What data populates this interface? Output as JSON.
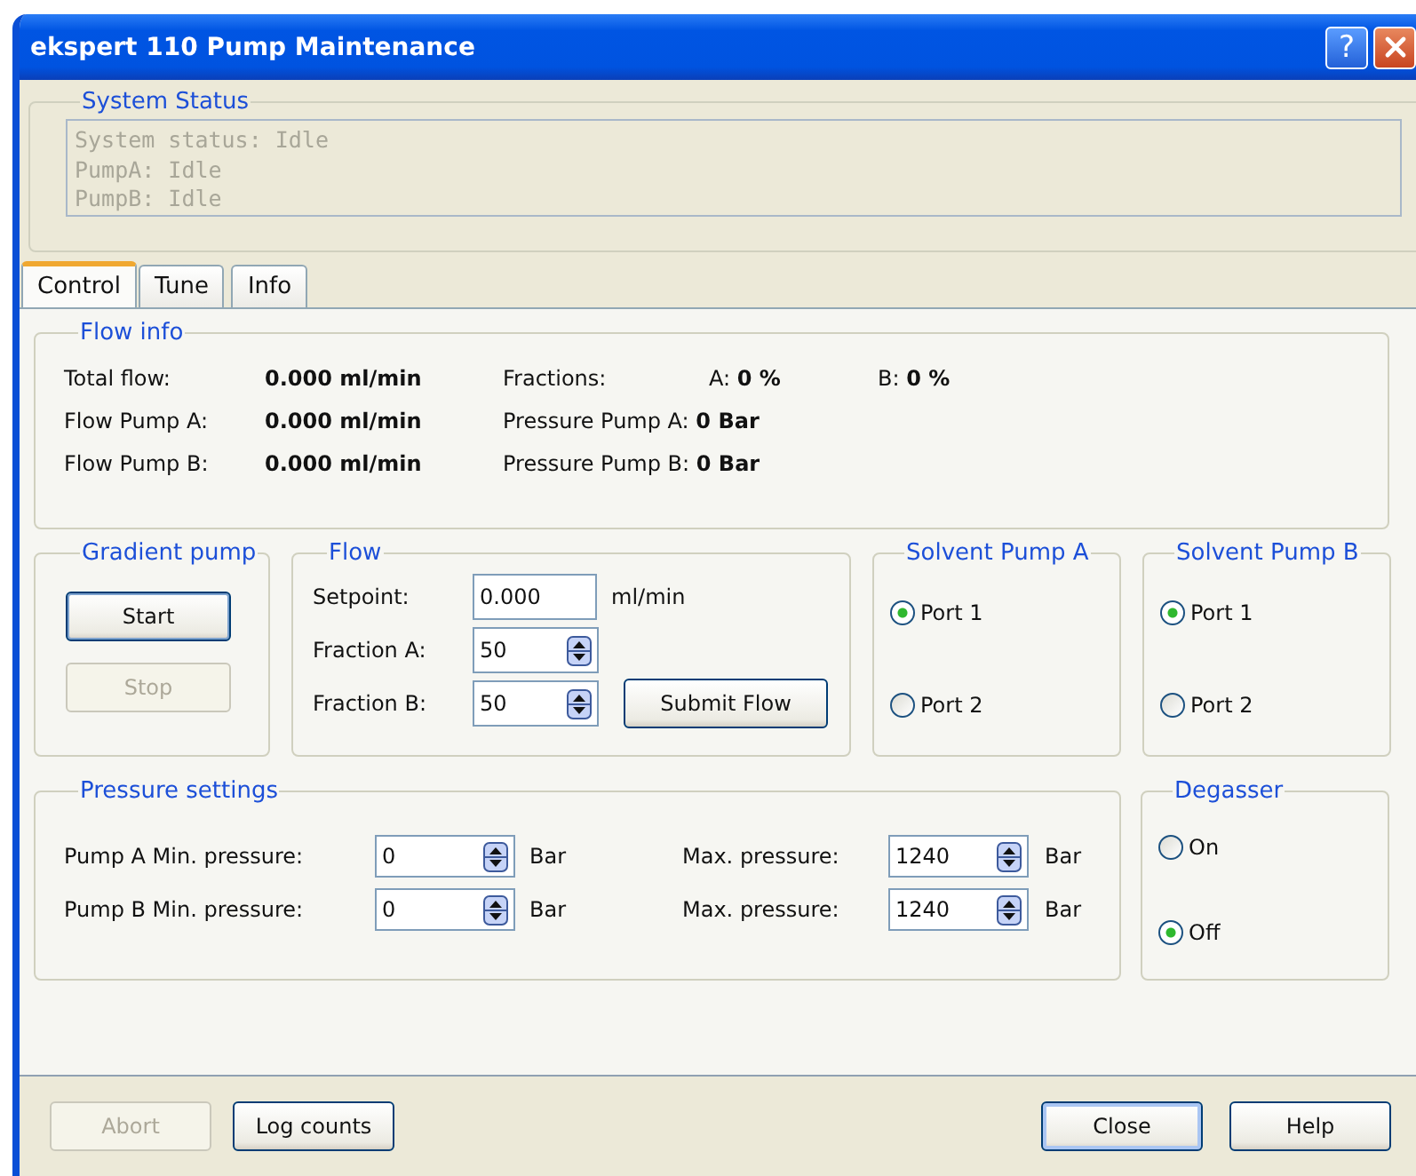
{
  "window": {
    "title": "ekspert 110 Pump Maintenance"
  },
  "title_buttons": [
    {
      "kind": "help",
      "label": "?"
    },
    {
      "kind": "close"
    }
  ],
  "system_status": {
    "title": "System Status",
    "lines": [
      "System status: Idle",
      "PumpA: Idle",
      "PumpB: Idle"
    ]
  },
  "tabs": [
    {
      "label": "Control",
      "selected": true
    },
    {
      "label": "Tune",
      "selected": false
    },
    {
      "label": "Info",
      "selected": false
    }
  ],
  "flow_info": {
    "title": "Flow info",
    "rows": [
      {
        "label": "Total flow:",
        "value": "0.000 ml/min",
        "info": [
          "Fractions:",
          "A: **0 %**",
          "B: **0 %**"
        ]
      },
      {
        "label": "Flow Pump A:",
        "value": "0.000 ml/min",
        "info": [
          "Pressure Pump A: **0 Bar**"
        ]
      },
      {
        "label": "Flow Pump B:",
        "value": "0.000 ml/min",
        "info": [
          "Pressure Pump B: **0 Bar**"
        ]
      }
    ]
  },
  "gradient_pump": {
    "title": "Gradient pump",
    "buttons": [
      {
        "label": "Start",
        "disabled": false
      },
      {
        "label": "Stop",
        "disabled": true
      }
    ]
  },
  "flow": {
    "title": "Flow",
    "setpoint": {
      "label": "Setpoint:",
      "value": "0.000",
      "unit": "ml/min"
    },
    "fractions": [
      {
        "label": "Fraction A:",
        "value": "50"
      },
      {
        "label": "Fraction B:",
        "value": "50"
      }
    ],
    "submit": "Submit Flow"
  },
  "solvent_pumps": [
    {
      "title": "Solvent Pump A",
      "options": [
        {
          "label": "Port 1",
          "selected": true
        },
        {
          "label": "Port 2",
          "selected": false
        }
      ]
    },
    {
      "title": "Solvent Pump B",
      "options": [
        {
          "label": "Port 1",
          "selected": true
        },
        {
          "label": "Port 2",
          "selected": false
        }
      ]
    }
  ],
  "pressure_settings": {
    "title": "Pressure settings",
    "rows": [
      {
        "label": "Pump A Min. pressure:",
        "min": "0",
        "unit": "Bar",
        "max_label": "Max. pressure:",
        "max": "1240",
        "max_unit": "Bar"
      },
      {
        "label": "Pump B Min. pressure:",
        "min": "0",
        "unit": "Bar",
        "max_label": "Max. pressure:",
        "max": "1240",
        "max_unit": "Bar"
      }
    ]
  },
  "degasser": {
    "title": "Degasser",
    "options": [
      {
        "label": "On",
        "selected": false
      },
      {
        "label": "Off",
        "selected": true
      }
    ]
  },
  "footer_buttons": [
    {
      "label": "Abort",
      "disabled": true,
      "default": false
    },
    {
      "label": "Log counts",
      "disabled": false,
      "default": false
    },
    {
      "label": "Close",
      "disabled": false,
      "default": true
    },
    {
      "label": "Help",
      "disabled": false,
      "default": false
    }
  ]
}
